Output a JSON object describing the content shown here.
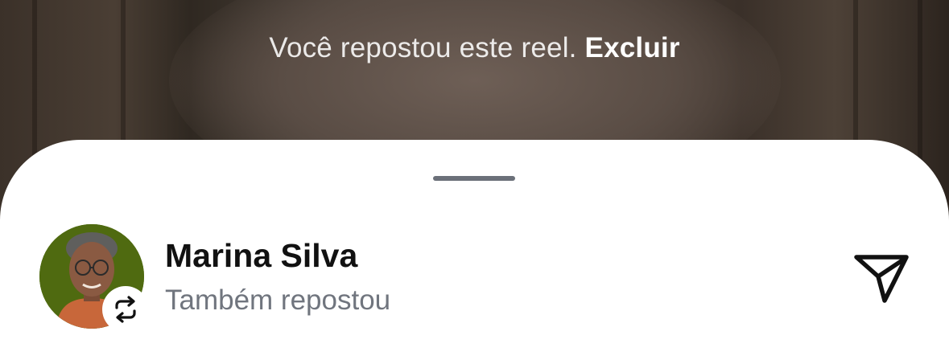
{
  "repost_notice": {
    "text": "Você repostou este reel.",
    "action_label": "Excluir"
  },
  "sheet": {
    "user": {
      "name": "Marina Silva",
      "subtitle": "Também repostou",
      "avatar_icon": "avatar-photo",
      "badge_icon": "repost-icon"
    },
    "share_icon": "send-icon"
  },
  "colors": {
    "sheet_background": "#ffffff",
    "name_text": "#111111",
    "subtitle_text": "#70757e",
    "grabber": "#6b7079",
    "avatar_background": "#4f6a10"
  }
}
